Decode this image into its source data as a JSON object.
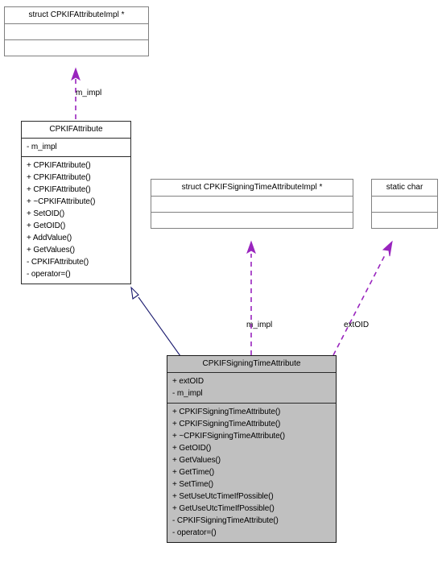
{
  "diagram": {
    "kind": "uml-class-diagram",
    "background": "#ffffff",
    "colors": {
      "class_fill": "#c0c0c0",
      "plain_fill": "#ffffff",
      "border": "#2b2b2b",
      "usage_edge": "#9925be",
      "inheritance_edge": "#1a1a6e"
    }
  },
  "nodes": {
    "attribute_impl": {
      "title": "struct CPKIFAttributeImpl *",
      "attributes": [],
      "operations": []
    },
    "cpkif_attribute": {
      "title": "CPKIFAttribute",
      "attributes": [
        "- m_impl"
      ],
      "operations": [
        "+ CPKIFAttribute()",
        "+ CPKIFAttribute()",
        "+ CPKIFAttribute()",
        "+ ~CPKIFAttribute()",
        "+ SetOID()",
        "+ GetOID()",
        "+ AddValue()",
        "+ GetValues()",
        "- CPKIFAttribute()",
        "- operator=()"
      ]
    },
    "signing_time_impl": {
      "title": "struct CPKIFSigningTimeAttributeImpl *",
      "attributes": [],
      "operations": []
    },
    "static_char": {
      "title": "static char",
      "attributes": [],
      "operations": []
    },
    "cpkif_signing_time_attribute": {
      "title": "CPKIFSigningTimeAttribute",
      "attributes": [
        "+ extOID",
        "- m_impl"
      ],
      "operations": [
        "+ CPKIFSigningTimeAttribute()",
        "+ CPKIFSigningTimeAttribute()",
        "+ ~CPKIFSigningTimeAttribute()",
        "+ GetOID()",
        "+ GetValues()",
        "+ GetTime()",
        "+ SetTime()",
        "+ SetUseUtcTimeIfPossible()",
        "+ GetUseUtcTimeIfPossible()",
        "- CPKIFSigningTimeAttribute()",
        "- operator=()"
      ]
    }
  },
  "edges": {
    "attribute_m_impl": {
      "label": "m_impl",
      "style": "dashed",
      "arrow": "open-filled",
      "from": "cpkif_attribute",
      "to": "attribute_impl"
    },
    "inheritance": {
      "label": "",
      "style": "solid",
      "arrow": "hollow-triangle",
      "from": "cpkif_signing_time_attribute",
      "to": "cpkif_attribute"
    },
    "signing_time_m_impl": {
      "label": "m_impl",
      "style": "dashed",
      "arrow": "open-filled",
      "from": "cpkif_signing_time_attribute",
      "to": "signing_time_impl"
    },
    "signing_time_extoid": {
      "label": "extOID",
      "style": "dashed",
      "arrow": "open-filled",
      "from": "cpkif_signing_time_attribute",
      "to": "static_char"
    }
  }
}
